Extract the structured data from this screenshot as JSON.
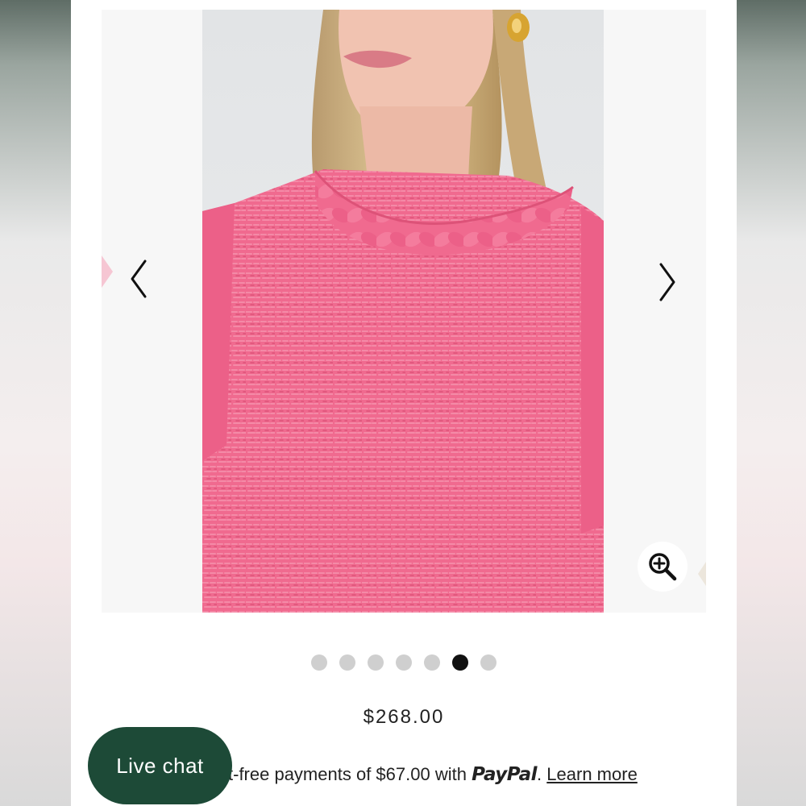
{
  "gallery": {
    "total_images": 7,
    "active_index": 5,
    "prev_icon": "chevron-left-icon",
    "next_icon": "chevron-right-icon",
    "zoom_icon": "zoom-in-icon"
  },
  "product": {
    "price": "$268.00",
    "paypal": {
      "text_before": "t-free payments of $67.00 with ",
      "brand": "PayPal",
      "separator": ".",
      "link": "Learn more"
    }
  },
  "chat": {
    "label": "Live chat"
  },
  "colors": {
    "sweater_pink": "#f06a8f",
    "active_dot": "#111111",
    "inactive_dot": "#cfcfcf",
    "chat_green": "#1d4a37"
  }
}
